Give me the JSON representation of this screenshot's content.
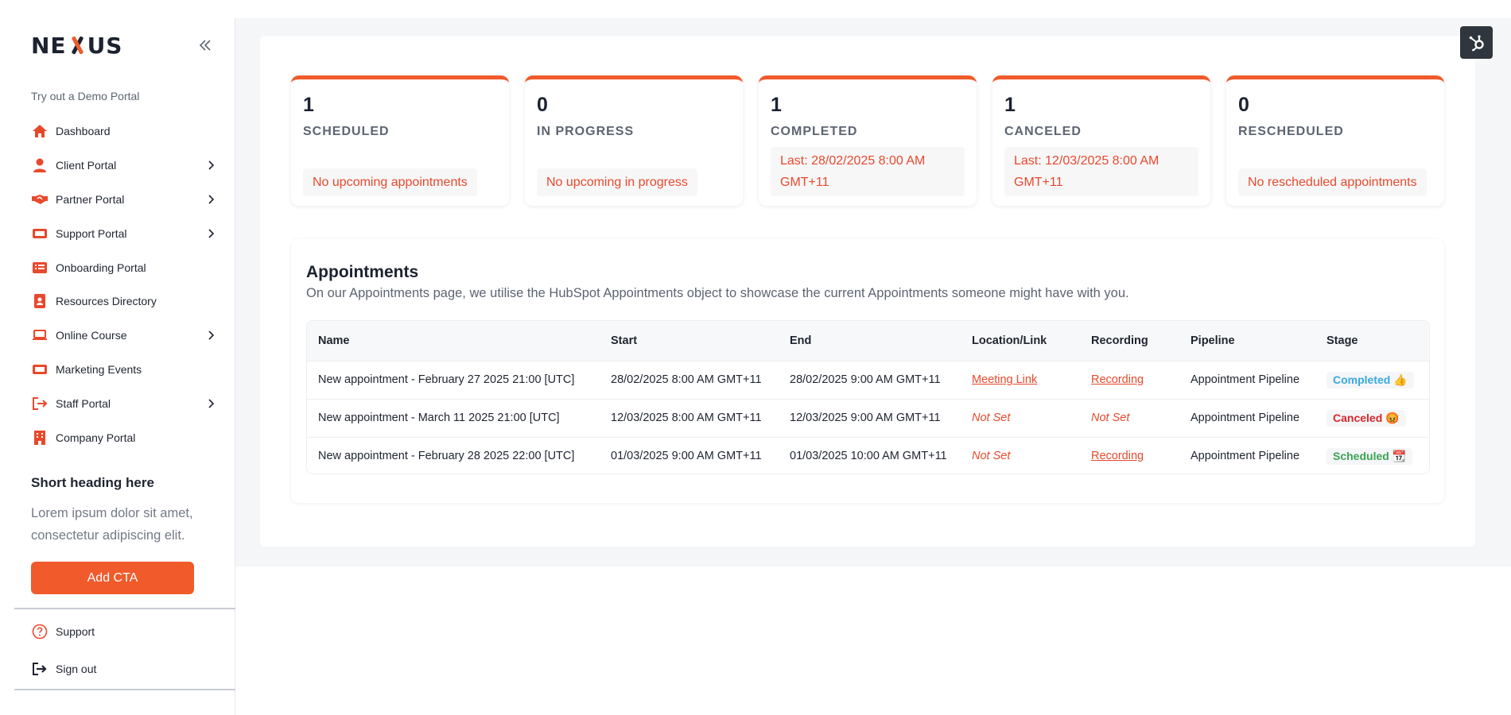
{
  "brand": {
    "logo_text_left": "NE",
    "logo_text_right": "US",
    "accent": "#f15a2b"
  },
  "sidebar": {
    "demo_label": "Try out a Demo Portal",
    "items": [
      {
        "label": "Dashboard",
        "icon": "home-icon",
        "has_chevron": false
      },
      {
        "label": "Client Portal",
        "icon": "user-icon",
        "has_chevron": true
      },
      {
        "label": "Partner Portal",
        "icon": "handshake-icon",
        "has_chevron": true
      },
      {
        "label": "Support Portal",
        "icon": "ticket-icon",
        "has_chevron": true
      },
      {
        "label": "Onboarding Portal",
        "icon": "list-icon",
        "has_chevron": false
      },
      {
        "label": "Resources Directory",
        "icon": "contact-book-icon",
        "has_chevron": false
      },
      {
        "label": "Online Course",
        "icon": "laptop-icon",
        "has_chevron": true
      },
      {
        "label": "Marketing Events",
        "icon": "ticket-icon",
        "has_chevron": false
      },
      {
        "label": "Staff Portal",
        "icon": "sign-in-icon",
        "has_chevron": true
      },
      {
        "label": "Company Portal",
        "icon": "building-icon",
        "has_chevron": false
      }
    ],
    "promo": {
      "heading": "Short heading here",
      "body": "Lorem ipsum dolor sit amet, consectetur adipiscing elit.",
      "cta": "Add CTA"
    },
    "footer": {
      "support": "Support",
      "sign_out": "Sign out"
    }
  },
  "stats": [
    {
      "count": "1",
      "title": "SCHEDULED",
      "note": "No upcoming appointments"
    },
    {
      "count": "0",
      "title": "IN PROGRESS",
      "note": "No upcoming in progress"
    },
    {
      "count": "1",
      "title": "COMPLETED",
      "note_line1": "Last: 28/02/2025 8:00 AM",
      "note_line2": "GMT+11"
    },
    {
      "count": "1",
      "title": "CANCELED",
      "note_line1": "Last: 12/03/2025 8:00 AM",
      "note_line2": "GMT+11"
    },
    {
      "count": "0",
      "title": "RESCHEDULED",
      "note": "No rescheduled appointments"
    }
  ],
  "appointments": {
    "title": "Appointments",
    "description": "On our Appointments page, we utilise the HubSpot Appointments object to showcase the current Appointments someone might have with you.",
    "columns": [
      "Name",
      "Start",
      "End",
      "Location/Link",
      "Recording",
      "Pipeline",
      "Stage"
    ],
    "rows": [
      {
        "name": "New appointment - February 27 2025 21:00 [UTC]",
        "start": "28/02/2025 8:00 AM GMT+11",
        "end": "28/02/2025 9:00 AM GMT+11",
        "location": "Meeting Link",
        "recording": "Recording",
        "pipeline": "Appointment Pipeline",
        "stage": "Completed 👍"
      },
      {
        "name": "New appointment - March 11 2025 21:00 [UTC]",
        "start": "12/03/2025 8:00 AM GMT+11",
        "end": "12/03/2025 9:00 AM GMT+11",
        "location": "Not Set",
        "recording": "Not Set",
        "pipeline": "Appointment Pipeline",
        "stage": "Canceled 😡"
      },
      {
        "name": "New appointment - February 28 2025 22:00 [UTC]",
        "start": "01/03/2025 9:00 AM GMT+11",
        "end": "01/03/2025 10:00 AM GMT+11",
        "location": "Not Set",
        "recording": "Recording",
        "pipeline": "Appointment Pipeline",
        "stage": "Scheduled 📆"
      }
    ]
  },
  "colors": {
    "completed": "#38a9dc",
    "canceled": "#d7262c",
    "scheduled": "#3aa552",
    "link": "#e8492c"
  }
}
